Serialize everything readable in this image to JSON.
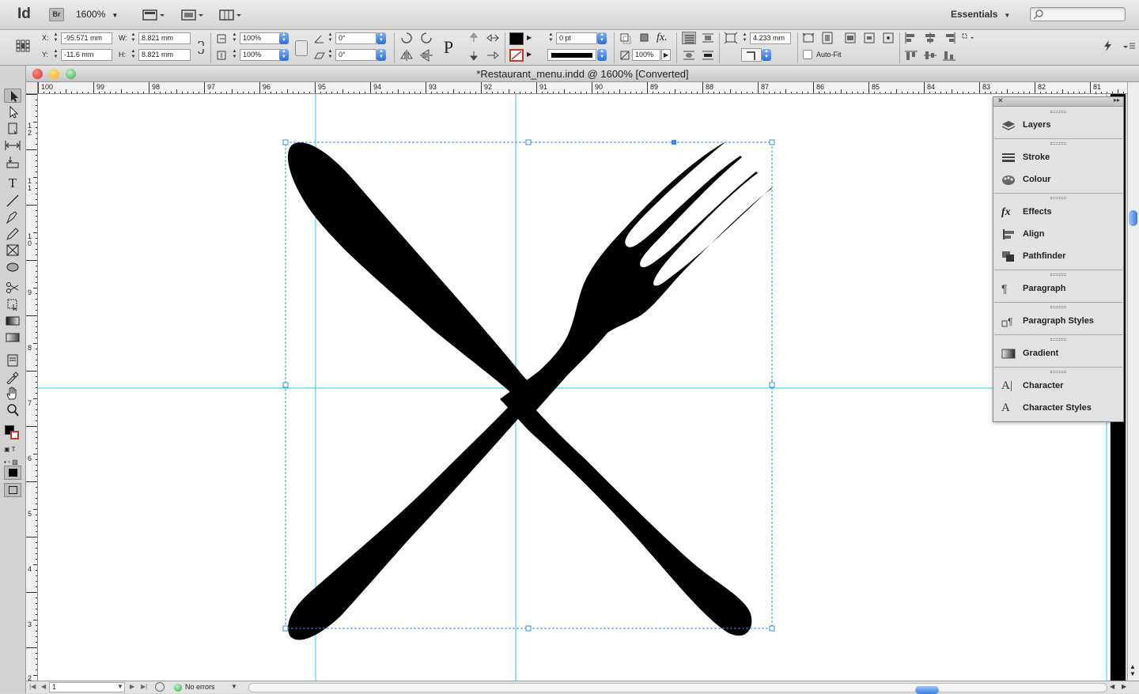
{
  "appbar": {
    "logo": "Id",
    "bridge": "Br",
    "zoom": "1600%",
    "workspace": "Essentials"
  },
  "control": {
    "x_label": "X:",
    "x_value": "-95.571 mm",
    "y_label": "Y:",
    "y_value": "-11.6 mm",
    "w_label": "W:",
    "w_value": "8.821 mm",
    "h_label": "H:",
    "h_value": "8.821 mm",
    "scale_x": "100%",
    "scale_y": "100%",
    "rotate": "0°",
    "shear": "0°",
    "stroke_weight": "0 pt",
    "opacity": "100%",
    "fitting_offset": "4.233 mm",
    "autofit_label": "Auto-Fit"
  },
  "document": {
    "title": "*Restaurant_menu.indd @ 1600% [Converted]"
  },
  "ruler": {
    "h": [
      "100",
      "99",
      "98",
      "97",
      "96",
      "95",
      "94",
      "93",
      "92",
      "91",
      "90",
      "89",
      "88",
      "87",
      "86",
      "85",
      "84",
      "83",
      "82",
      "81"
    ],
    "v": [
      "1 2",
      "1 1",
      "1 0",
      "9",
      "8",
      "7",
      "6",
      "5",
      "4",
      "3",
      "2"
    ]
  },
  "status": {
    "page": "1",
    "preflight": "No errors"
  },
  "panel": {
    "items": [
      {
        "label": "Layers",
        "icon": "layers-icon"
      },
      {
        "label": "Stroke",
        "icon": "stroke-icon"
      },
      {
        "label": "Colour",
        "icon": "colour-icon"
      },
      {
        "label": "Effects",
        "icon": "effects-icon"
      },
      {
        "label": "Align",
        "icon": "align-icon"
      },
      {
        "label": "Pathfinder",
        "icon": "pathfinder-icon"
      },
      {
        "label": "Paragraph",
        "icon": "paragraph-icon"
      },
      {
        "label": "Paragraph Styles",
        "icon": "paragraph-styles-icon"
      },
      {
        "label": "Gradient",
        "icon": "gradient-icon"
      },
      {
        "label": "Character",
        "icon": "character-icon"
      },
      {
        "label": "Character Styles",
        "icon": "character-styles-icon"
      }
    ]
  },
  "colors": {
    "guide": "#22d3e6",
    "selection": "#2f8ee8",
    "artwork": "#000000"
  }
}
